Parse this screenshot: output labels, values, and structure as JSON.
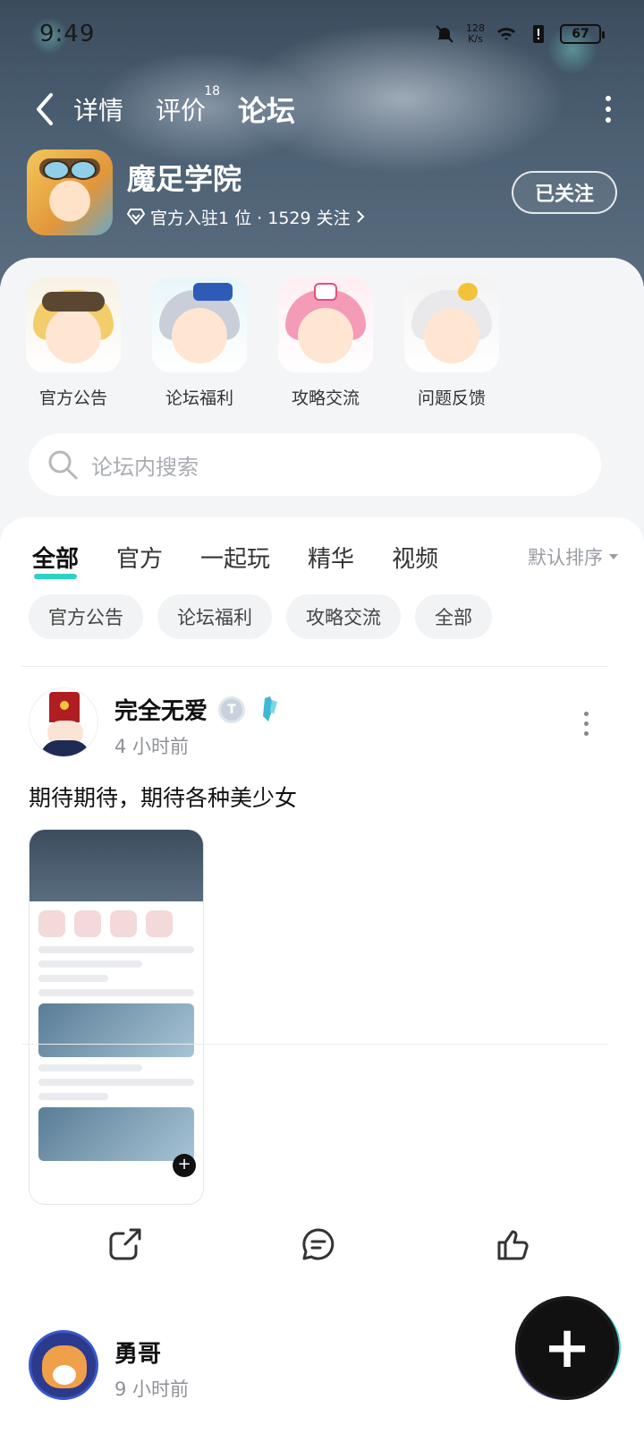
{
  "status_bar": {
    "time": "9:49",
    "net_speed_top": "128",
    "net_speed_bottom": "K/s",
    "battery": "67"
  },
  "nav": {
    "tabs": [
      {
        "label": "详情"
      },
      {
        "label": "评价",
        "badge": "18"
      },
      {
        "label": "论坛"
      }
    ]
  },
  "game": {
    "title": "魔足学院",
    "subtitle": "官方入驻1 位 · 1529 关注",
    "follow_label": "已关注"
  },
  "categories": [
    {
      "label": "官方公告"
    },
    {
      "label": "论坛福利"
    },
    {
      "label": "攻略交流"
    },
    {
      "label": "问题反馈"
    }
  ],
  "search": {
    "placeholder": "论坛内搜索"
  },
  "feed_tabs": [
    {
      "label": "全部"
    },
    {
      "label": "官方"
    },
    {
      "label": "一起玩"
    },
    {
      "label": "精华"
    },
    {
      "label": "视频"
    }
  ],
  "sort_label": "默认排序",
  "chips": [
    {
      "label": "官方公告"
    },
    {
      "label": "论坛福利"
    },
    {
      "label": "攻略交流"
    },
    {
      "label": "全部"
    }
  ],
  "posts": [
    {
      "username": "完全无爱",
      "time": "4 小时前",
      "text": "期待期待，期待各种美少女"
    },
    {
      "username": "勇哥",
      "time": "9 小时前"
    }
  ],
  "colors": {
    "accent": "#2bd3c3",
    "header_bg": "#4b5f72"
  }
}
